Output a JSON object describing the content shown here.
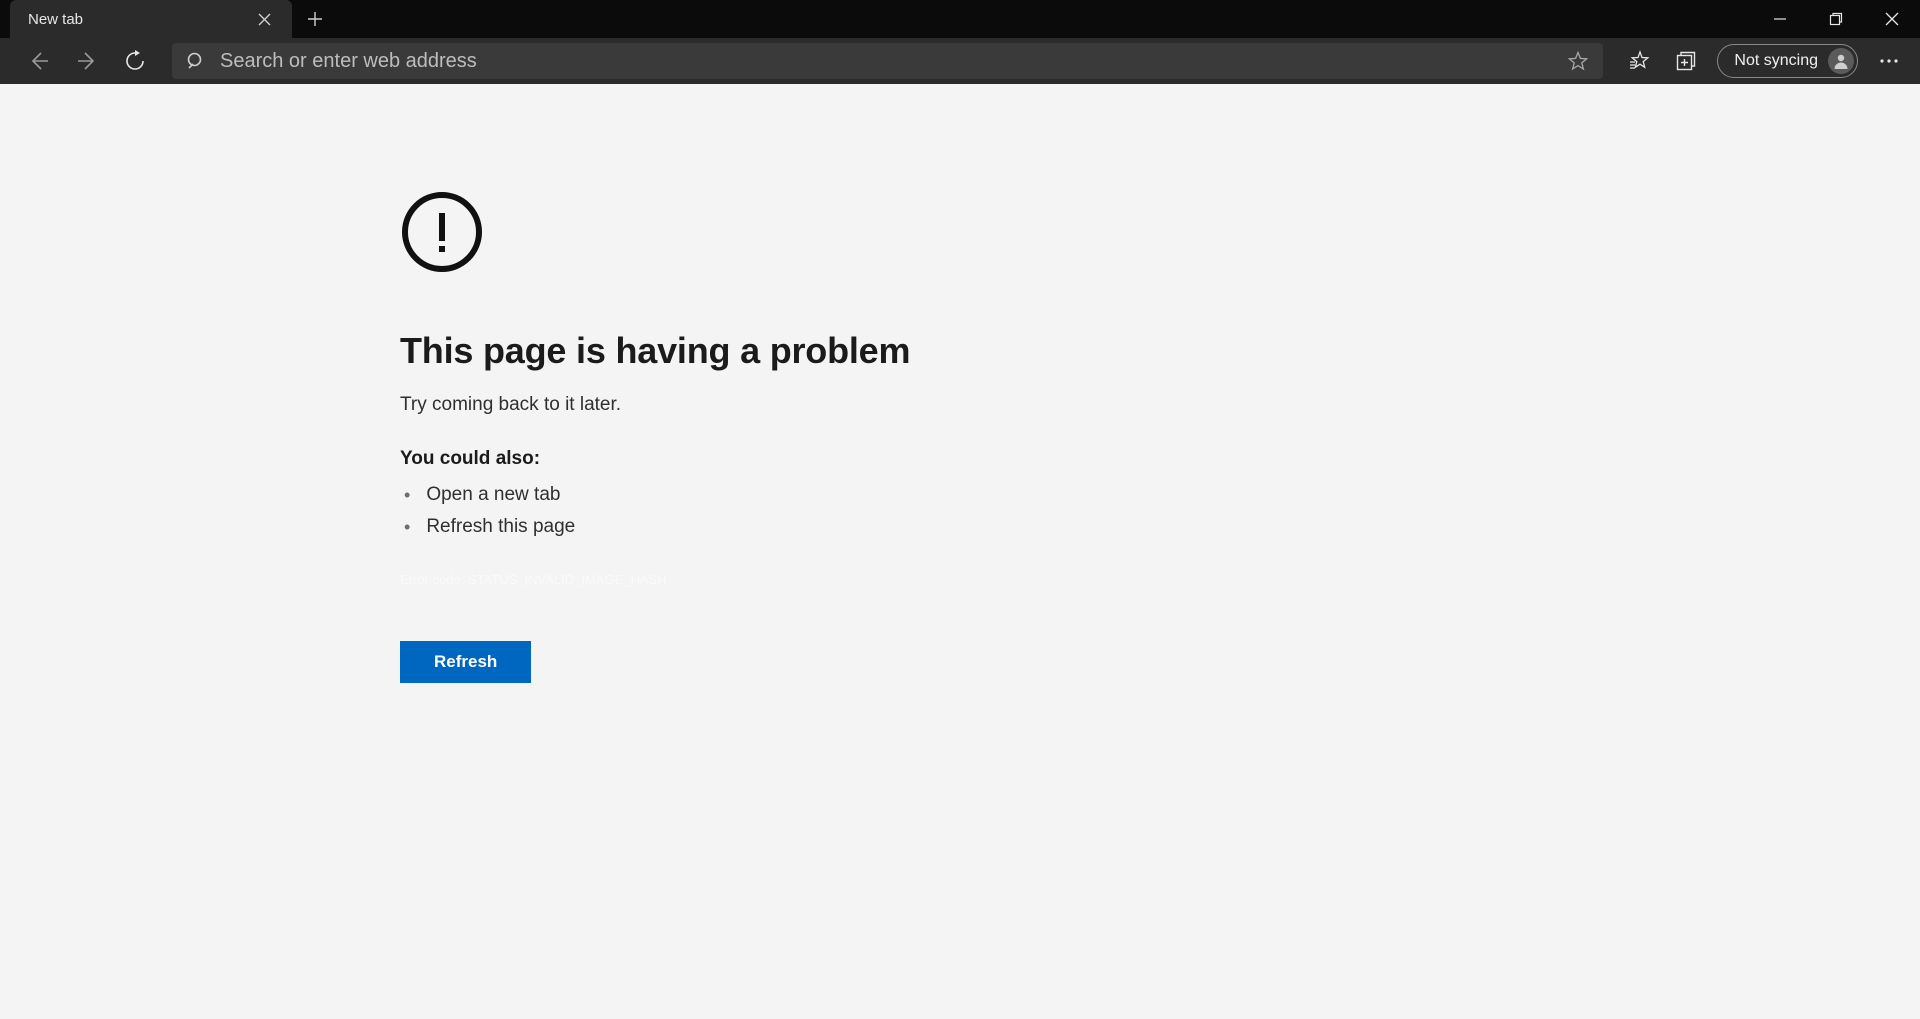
{
  "tab": {
    "title": "New tab"
  },
  "addressbar": {
    "placeholder": "Search or enter web address"
  },
  "profile": {
    "label": "Not syncing"
  },
  "error": {
    "title": "This page is having a problem",
    "subtitle": "Try coming back to it later.",
    "also_label": "You could also:",
    "suggestions": [
      "Open a new tab",
      "Refresh this page"
    ],
    "error_code": "Error code: STATUS_INVALID_IMAGE_HASH",
    "refresh_label": "Refresh"
  }
}
